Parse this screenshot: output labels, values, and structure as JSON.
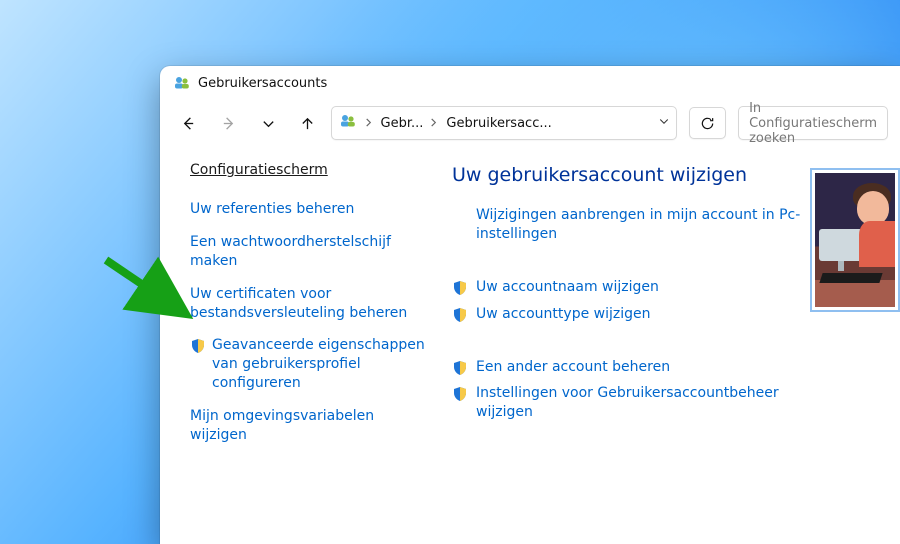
{
  "titlebar": {
    "title": "Gebruikersaccounts"
  },
  "addressbar": {
    "crumb1": "Gebr...",
    "crumb2": "Gebruikersacc..."
  },
  "search": {
    "placeholder": "In Configuratiescherm zoeken"
  },
  "sidebar": {
    "home": "Configuratiescherm",
    "tasks": {
      "referenties": "Uw referenties beheren",
      "herstelschijf": "Een wachtwoordherstelschijf maken",
      "certificaten": "Uw certificaten voor bestandsversleuteling beheren",
      "geavanceerd": "Geavanceerde eigenschappen van gebruikersprofiel configureren",
      "omgeving": "Mijn omgevingsvariabelen wijzigen"
    }
  },
  "main": {
    "heading": "Uw gebruikersaccount wijzigen",
    "links": {
      "pc_settings": "Wijzigingen aanbrengen in mijn account in Pc-instellingen",
      "accountnaam": "Uw accountnaam wijzigen",
      "accounttype": "Uw accounttype wijzigen",
      "ander_account": "Een ander account beheren",
      "uac": "Instellingen voor Gebruikersaccountbeheer wijzigen"
    }
  }
}
